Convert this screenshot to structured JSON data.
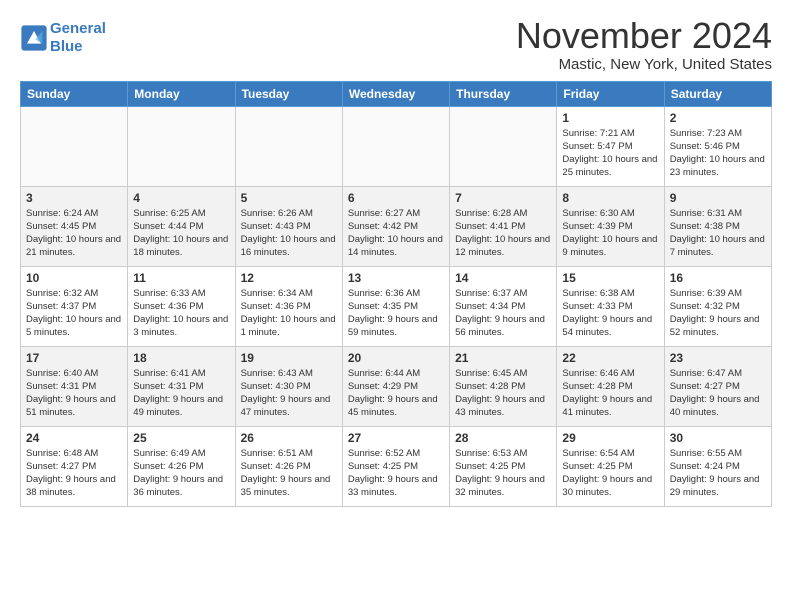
{
  "logo": {
    "line1": "General",
    "line2": "Blue"
  },
  "title": "November 2024",
  "location": "Mastic, New York, United States",
  "weekdays": [
    "Sunday",
    "Monday",
    "Tuesday",
    "Wednesday",
    "Thursday",
    "Friday",
    "Saturday"
  ],
  "weeks": [
    [
      {
        "day": "",
        "info": ""
      },
      {
        "day": "",
        "info": ""
      },
      {
        "day": "",
        "info": ""
      },
      {
        "day": "",
        "info": ""
      },
      {
        "day": "",
        "info": ""
      },
      {
        "day": "1",
        "info": "Sunrise: 7:21 AM\nSunset: 5:47 PM\nDaylight: 10 hours and 25 minutes."
      },
      {
        "day": "2",
        "info": "Sunrise: 7:23 AM\nSunset: 5:46 PM\nDaylight: 10 hours and 23 minutes."
      }
    ],
    [
      {
        "day": "3",
        "info": "Sunrise: 6:24 AM\nSunset: 4:45 PM\nDaylight: 10 hours and 21 minutes."
      },
      {
        "day": "4",
        "info": "Sunrise: 6:25 AM\nSunset: 4:44 PM\nDaylight: 10 hours and 18 minutes."
      },
      {
        "day": "5",
        "info": "Sunrise: 6:26 AM\nSunset: 4:43 PM\nDaylight: 10 hours and 16 minutes."
      },
      {
        "day": "6",
        "info": "Sunrise: 6:27 AM\nSunset: 4:42 PM\nDaylight: 10 hours and 14 minutes."
      },
      {
        "day": "7",
        "info": "Sunrise: 6:28 AM\nSunset: 4:41 PM\nDaylight: 10 hours and 12 minutes."
      },
      {
        "day": "8",
        "info": "Sunrise: 6:30 AM\nSunset: 4:39 PM\nDaylight: 10 hours and 9 minutes."
      },
      {
        "day": "9",
        "info": "Sunrise: 6:31 AM\nSunset: 4:38 PM\nDaylight: 10 hours and 7 minutes."
      }
    ],
    [
      {
        "day": "10",
        "info": "Sunrise: 6:32 AM\nSunset: 4:37 PM\nDaylight: 10 hours and 5 minutes."
      },
      {
        "day": "11",
        "info": "Sunrise: 6:33 AM\nSunset: 4:36 PM\nDaylight: 10 hours and 3 minutes."
      },
      {
        "day": "12",
        "info": "Sunrise: 6:34 AM\nSunset: 4:36 PM\nDaylight: 10 hours and 1 minute."
      },
      {
        "day": "13",
        "info": "Sunrise: 6:36 AM\nSunset: 4:35 PM\nDaylight: 9 hours and 59 minutes."
      },
      {
        "day": "14",
        "info": "Sunrise: 6:37 AM\nSunset: 4:34 PM\nDaylight: 9 hours and 56 minutes."
      },
      {
        "day": "15",
        "info": "Sunrise: 6:38 AM\nSunset: 4:33 PM\nDaylight: 9 hours and 54 minutes."
      },
      {
        "day": "16",
        "info": "Sunrise: 6:39 AM\nSunset: 4:32 PM\nDaylight: 9 hours and 52 minutes."
      }
    ],
    [
      {
        "day": "17",
        "info": "Sunrise: 6:40 AM\nSunset: 4:31 PM\nDaylight: 9 hours and 51 minutes."
      },
      {
        "day": "18",
        "info": "Sunrise: 6:41 AM\nSunset: 4:31 PM\nDaylight: 9 hours and 49 minutes."
      },
      {
        "day": "19",
        "info": "Sunrise: 6:43 AM\nSunset: 4:30 PM\nDaylight: 9 hours and 47 minutes."
      },
      {
        "day": "20",
        "info": "Sunrise: 6:44 AM\nSunset: 4:29 PM\nDaylight: 9 hours and 45 minutes."
      },
      {
        "day": "21",
        "info": "Sunrise: 6:45 AM\nSunset: 4:28 PM\nDaylight: 9 hours and 43 minutes."
      },
      {
        "day": "22",
        "info": "Sunrise: 6:46 AM\nSunset: 4:28 PM\nDaylight: 9 hours and 41 minutes."
      },
      {
        "day": "23",
        "info": "Sunrise: 6:47 AM\nSunset: 4:27 PM\nDaylight: 9 hours and 40 minutes."
      }
    ],
    [
      {
        "day": "24",
        "info": "Sunrise: 6:48 AM\nSunset: 4:27 PM\nDaylight: 9 hours and 38 minutes."
      },
      {
        "day": "25",
        "info": "Sunrise: 6:49 AM\nSunset: 4:26 PM\nDaylight: 9 hours and 36 minutes."
      },
      {
        "day": "26",
        "info": "Sunrise: 6:51 AM\nSunset: 4:26 PM\nDaylight: 9 hours and 35 minutes."
      },
      {
        "day": "27",
        "info": "Sunrise: 6:52 AM\nSunset: 4:25 PM\nDaylight: 9 hours and 33 minutes."
      },
      {
        "day": "28",
        "info": "Sunrise: 6:53 AM\nSunset: 4:25 PM\nDaylight: 9 hours and 32 minutes."
      },
      {
        "day": "29",
        "info": "Sunrise: 6:54 AM\nSunset: 4:25 PM\nDaylight: 9 hours and 30 minutes."
      },
      {
        "day": "30",
        "info": "Sunrise: 6:55 AM\nSunset: 4:24 PM\nDaylight: 9 hours and 29 minutes."
      }
    ]
  ]
}
